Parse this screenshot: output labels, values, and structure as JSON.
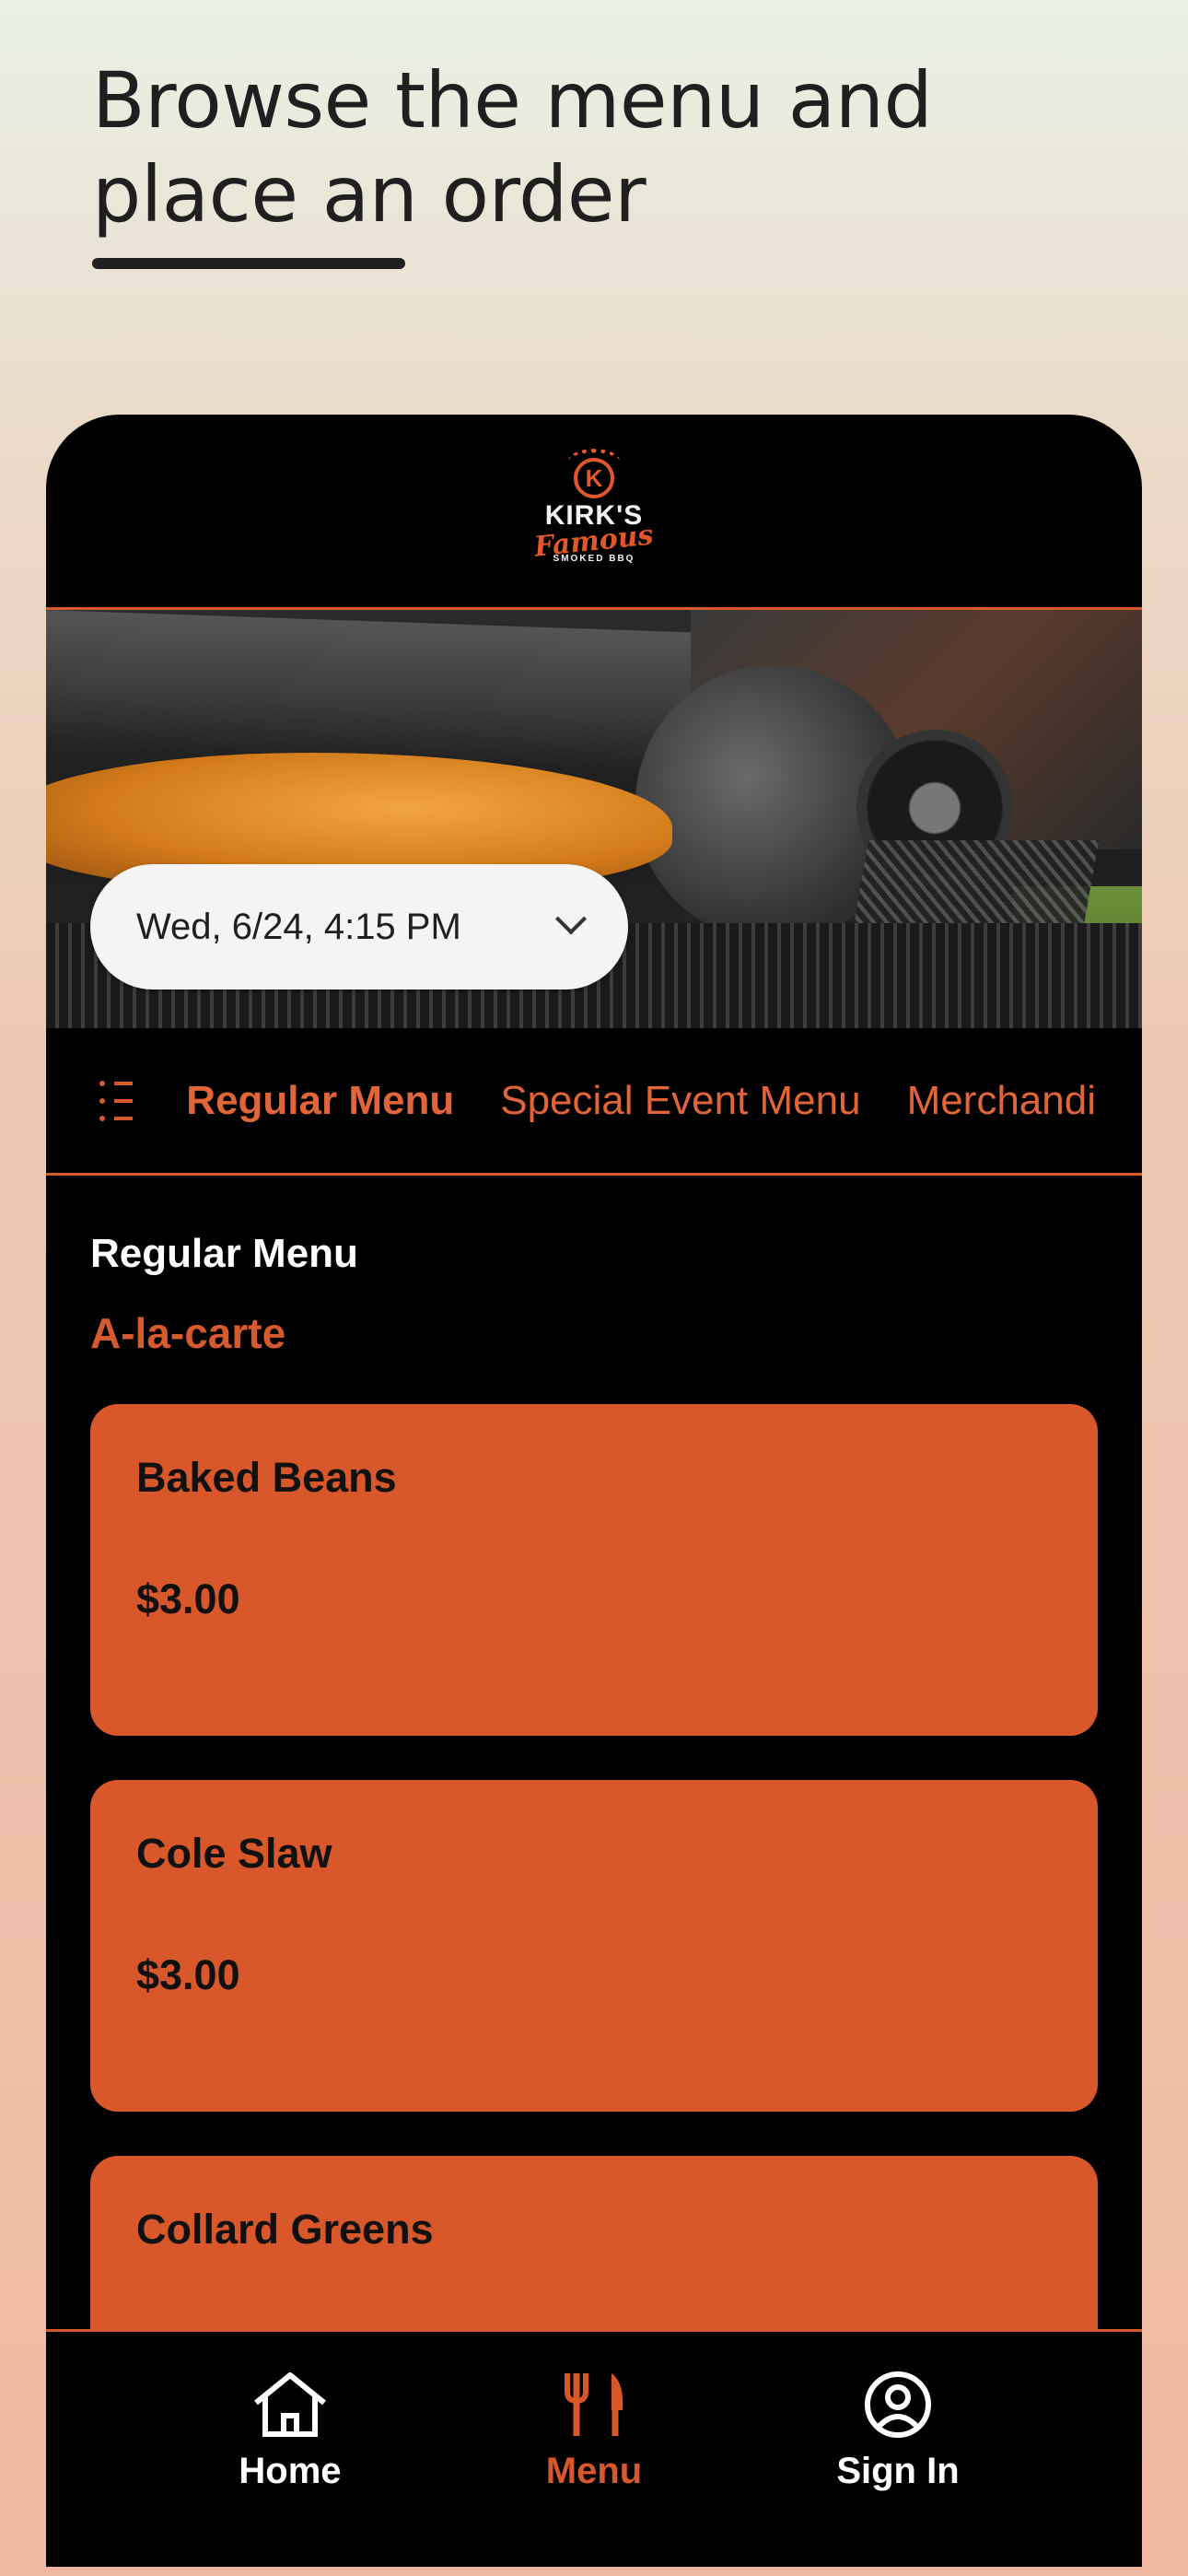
{
  "heading": {
    "line1": "Browse the menu and",
    "line2": "place an order"
  },
  "brand": {
    "logo_letter": "K",
    "name": "KIRK'S",
    "script": "Famous",
    "subtitle": "SMOKED BBQ",
    "accent_color": "#d9582b"
  },
  "order_time": {
    "value": "Wed, 6/24, 4:15 PM"
  },
  "tabs": [
    {
      "label": "Regular Menu",
      "active": true
    },
    {
      "label": "Special Event Menu",
      "active": false
    },
    {
      "label": "Merchandi",
      "active": false
    }
  ],
  "menu": {
    "title": "Regular Menu",
    "category": "A-la-carte",
    "items": [
      {
        "name": "Baked Beans",
        "price": "$3.00"
      },
      {
        "name": "Cole Slaw",
        "price": "$3.00"
      },
      {
        "name": "Collard Greens",
        "price": ""
      }
    ]
  },
  "bottom_nav": [
    {
      "label": "Home",
      "icon": "home-icon"
    },
    {
      "label": "Menu",
      "icon": "fork-knife-icon",
      "active": true
    },
    {
      "label": "Sign In",
      "icon": "user-circle-icon"
    }
  ]
}
